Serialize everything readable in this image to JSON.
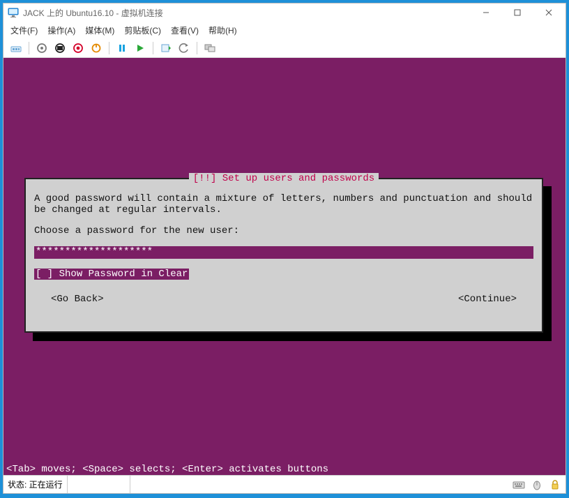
{
  "window": {
    "title": "JACK 上的 Ubuntu16.10 - 虚拟机连接"
  },
  "menu": {
    "file": "文件(F)",
    "action": "操作(A)",
    "media": "媒体(M)",
    "clip": "剪贴板(C)",
    "view": "查看(V)",
    "help": "帮助(H)"
  },
  "installer": {
    "title": "[!!] Set up users and passwords",
    "msg": "A good password will contain a mixture of letters, numbers and punctuation and should be changed at regular intervals.",
    "prompt": "Choose a password for the new user:",
    "pw_masked": "********************",
    "show_clear_prefix": "[ ] ",
    "show_clear_label": "Show Password in Clear",
    "go_back": "<Go Back>",
    "cont": "<Continue>",
    "hint": "<Tab> moves; <Space> selects; <Enter> activates buttons"
  },
  "status": {
    "label": "状态: 正在运行"
  }
}
